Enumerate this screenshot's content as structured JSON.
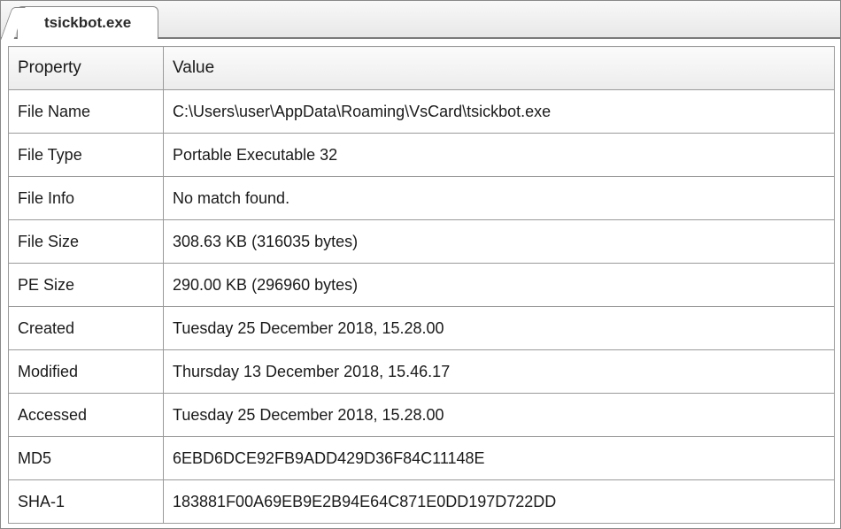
{
  "tab": {
    "label": "tsickbot.exe"
  },
  "table": {
    "headers": {
      "property": "Property",
      "value": "Value"
    },
    "rows": [
      {
        "property": "File Name",
        "value": "C:\\Users\\user\\AppData\\Roaming\\VsCard\\tsickbot.exe"
      },
      {
        "property": "File Type",
        "value": "Portable Executable 32"
      },
      {
        "property": "File Info",
        "value": "No match found."
      },
      {
        "property": "File Size",
        "value": "308.63 KB (316035 bytes)"
      },
      {
        "property": "PE Size",
        "value": "290.00 KB (296960 bytes)"
      },
      {
        "property": "Created",
        "value": "Tuesday 25 December 2018, 15.28.00"
      },
      {
        "property": "Modified",
        "value": "Thursday 13 December 2018, 15.46.17"
      },
      {
        "property": "Accessed",
        "value": "Tuesday 25 December 2018, 15.28.00"
      },
      {
        "property": "MD5",
        "value": "6EBD6DCE92FB9ADD429D36F84C11148E"
      },
      {
        "property": "SHA-1",
        "value": "183881F00A69EB9E2B94E64C871E0DD197D722DD"
      }
    ]
  }
}
